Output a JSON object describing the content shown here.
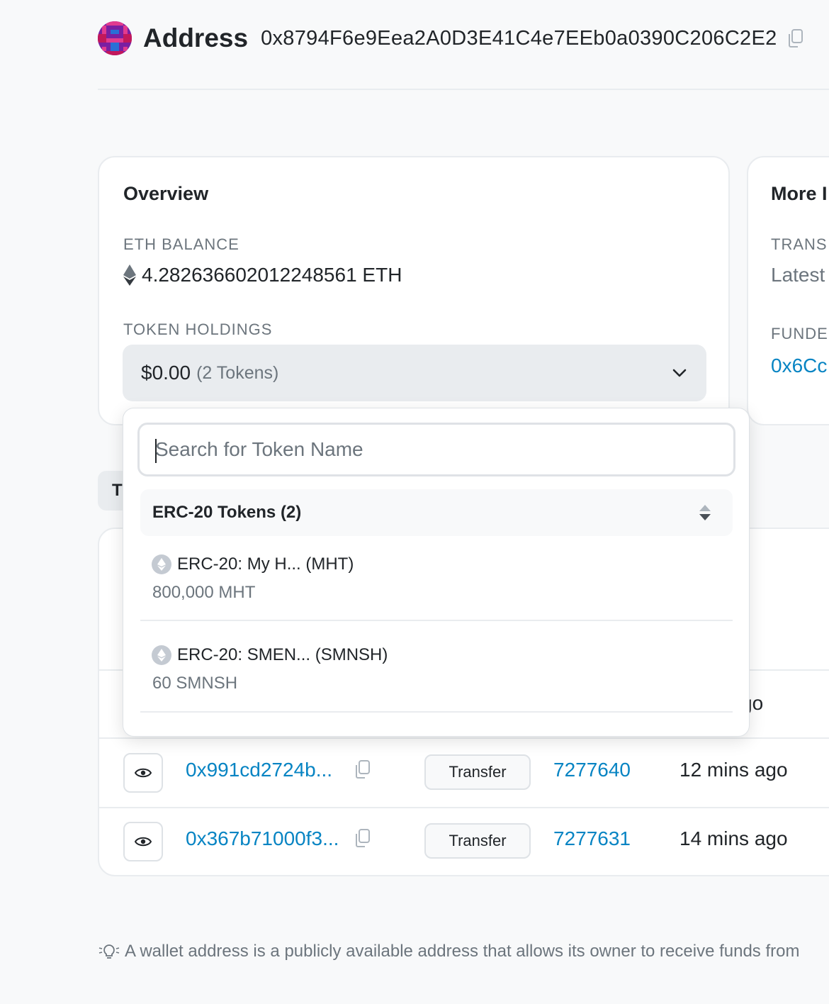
{
  "header": {
    "title": "Address",
    "address": "0x8794F6e9Eea2A0D3E41C4e7EEb0a0390C206C2E2"
  },
  "overview": {
    "title": "Overview",
    "eth_balance_label": "ETH BALANCE",
    "eth_balance_value": "4.282636602012248561 ETH",
    "token_holdings_label": "TOKEN HOLDINGS",
    "token_holdings_usd": "$0.00",
    "token_holdings_count": "(2 Tokens)"
  },
  "more_info": {
    "title": "More I",
    "transactions_label": "TRANS",
    "transactions_value": "Latest",
    "funded_label": "FUNDEI",
    "funded_value": "0x6Cc"
  },
  "tab_stub": "T",
  "token_dropdown": {
    "search_placeholder": "Search for Token Name",
    "group_label": "ERC-20 Tokens (2)",
    "tokens": [
      {
        "name": "ERC-20: My H... (MHT)",
        "amount": "800,000 MHT"
      },
      {
        "name": "ERC-20: SMEN... (SMNSH)",
        "amount": "60 SMNSH"
      }
    ]
  },
  "transactions": {
    "partial_age": "go",
    "rows": [
      {
        "hash": "0x991cd2724b...",
        "method": "Transfer",
        "block": "7277640",
        "age": "12 mins ago"
      },
      {
        "hash": "0x367b71000f3...",
        "method": "Transfer",
        "block": "7277631",
        "age": "14 mins ago"
      }
    ]
  },
  "footer": {
    "hint": "A wallet address is a publicly available address that allows its owner to receive funds from"
  },
  "colors": {
    "link": "#0784c3",
    "muted": "#6c757d",
    "border": "#e9ecef"
  },
  "icons": [
    "avatar-identicon",
    "copy-icon",
    "ethereum-icon",
    "chevron-down-icon",
    "sort-icon",
    "eye-icon",
    "lightbulb-icon"
  ]
}
